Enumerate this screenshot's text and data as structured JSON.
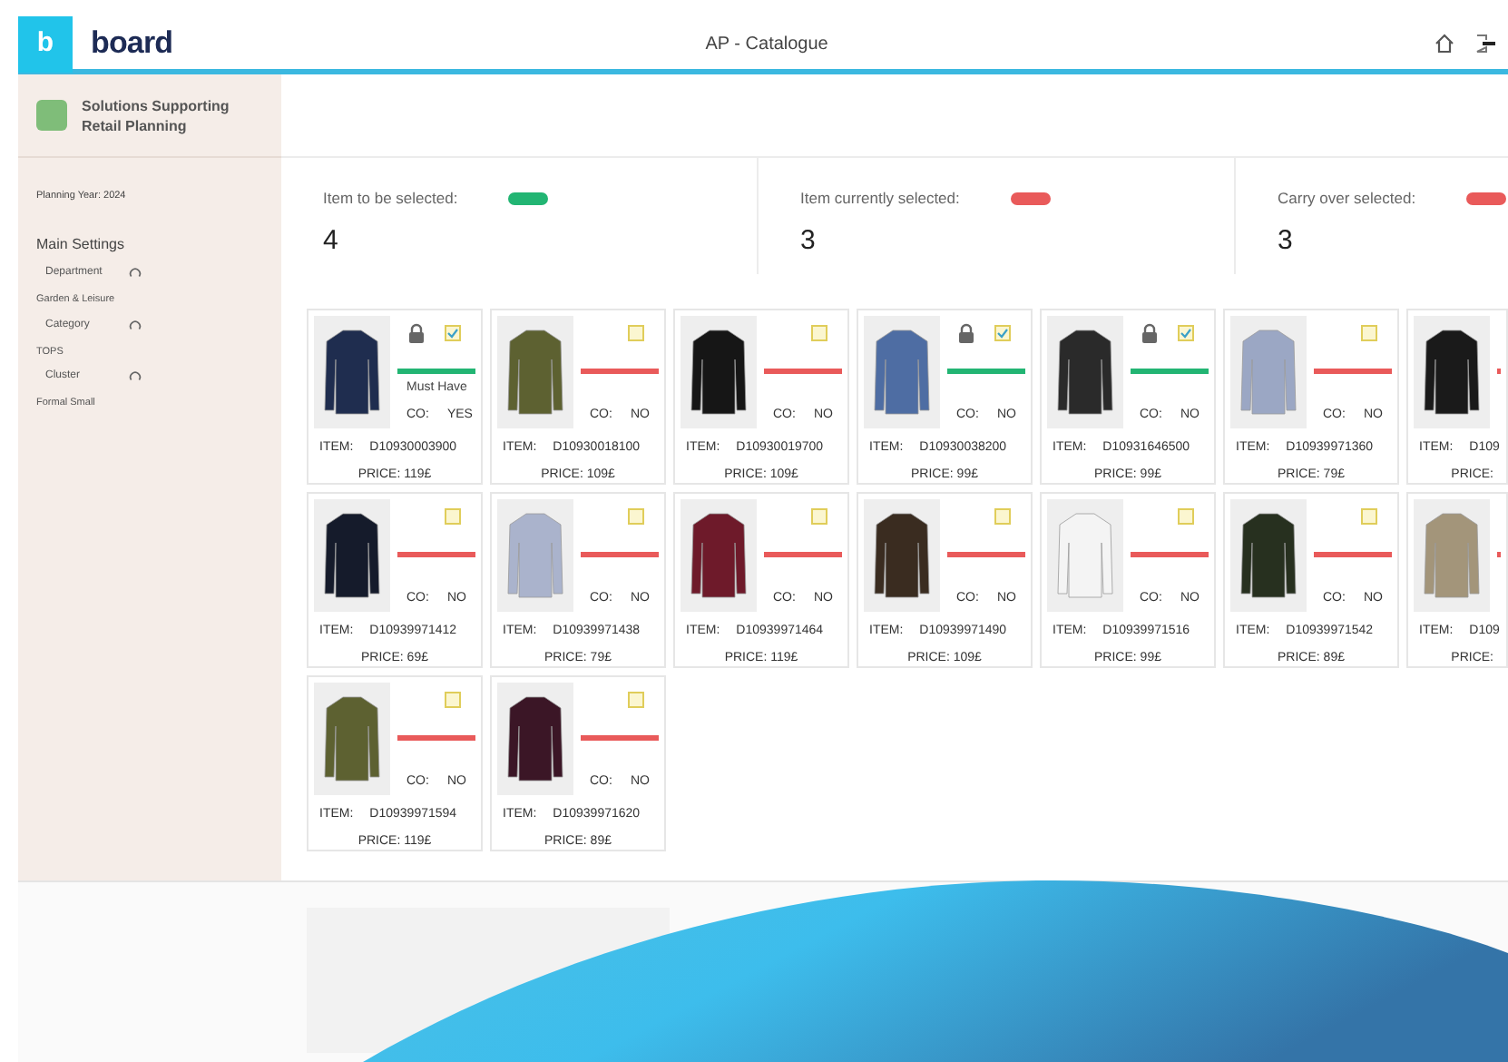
{
  "header": {
    "logo": "b",
    "brand": "board",
    "title": "AP - Catalogue"
  },
  "sidebar": {
    "app_name": [
      "Solutions Supporting",
      "Retail Planning"
    ],
    "planning_year": "Planning Year: 2024",
    "section": "Main Settings",
    "settings": [
      {
        "label": "Department",
        "value": "Garden & Leisure"
      },
      {
        "label": "Category",
        "value": "TOPS"
      },
      {
        "label": "Cluster",
        "value": "Formal Small"
      }
    ]
  },
  "kpis": [
    {
      "label": "Item to be selected:",
      "value": "4",
      "color": "#22b573"
    },
    {
      "label": "Item currently selected:",
      "value": "3",
      "color": "#e95a5a"
    },
    {
      "label": "Carry over selected:",
      "value": "3",
      "color": "#e95a5a"
    }
  ],
  "products": [
    {
      "item_label": "ITEM:",
      "item": "D10930003900",
      "price": "PRICE: 119£",
      "co_label": "CO:",
      "co": "YES",
      "locked": true,
      "checked": true,
      "tag": "Must Have",
      "color": "#1f2d4f"
    },
    {
      "item_label": "ITEM:",
      "item": "D10930018100",
      "price": "PRICE: 109£",
      "co_label": "CO:",
      "co": "NO",
      "locked": false,
      "checked": false,
      "color": "#5d6131"
    },
    {
      "item_label": "ITEM:",
      "item": "D10930019700",
      "price": "PRICE: 109£",
      "co_label": "CO:",
      "co": "NO",
      "locked": false,
      "checked": false,
      "color": "#161616"
    },
    {
      "item_label": "ITEM:",
      "item": "D10930038200",
      "price": "PRICE: 99£",
      "co_label": "CO:",
      "co": "NO",
      "locked": true,
      "checked": true,
      "color": "#4e6da3"
    },
    {
      "item_label": "ITEM:",
      "item": "D10931646500",
      "price": "PRICE: 99£",
      "co_label": "CO:",
      "co": "NO",
      "locked": true,
      "checked": true,
      "color": "#2a2a2a"
    },
    {
      "item_label": "ITEM:",
      "item": "D10939971360",
      "price": "PRICE: 79£",
      "co_label": "CO:",
      "co": "NO",
      "locked": false,
      "checked": false,
      "color": "#9ba7c4"
    },
    {
      "item_label": "ITEM:",
      "item": "D109",
      "price": "PRICE:",
      "color": "#1a1a1a"
    },
    {
      "item_label": "ITEM:",
      "item": "D10939971412",
      "price": "PRICE: 69£",
      "co_label": "CO:",
      "co": "NO",
      "locked": false,
      "checked": false,
      "color": "#151b2b"
    },
    {
      "item_label": "ITEM:",
      "item": "D10939971438",
      "price": "PRICE: 79£",
      "co_label": "CO:",
      "co": "NO",
      "locked": false,
      "checked": false,
      "color": "#aab3cc"
    },
    {
      "item_label": "ITEM:",
      "item": "D10939971464",
      "price": "PRICE: 119£",
      "co_label": "CO:",
      "co": "NO",
      "locked": false,
      "checked": false,
      "color": "#6e1a2a"
    },
    {
      "item_label": "ITEM:",
      "item": "D10939971490",
      "price": "PRICE: 109£",
      "co_label": "CO:",
      "co": "NO",
      "locked": false,
      "checked": false,
      "color": "#3a2c20"
    },
    {
      "item_label": "ITEM:",
      "item": "D10939971516",
      "price": "PRICE: 99£",
      "co_label": "CO:",
      "co": "NO",
      "locked": false,
      "checked": false,
      "color": "#f4f4f4"
    },
    {
      "item_label": "ITEM:",
      "item": "D10939971542",
      "price": "PRICE: 89£",
      "co_label": "CO:",
      "co": "NO",
      "locked": false,
      "checked": false,
      "color": "#27301f"
    },
    {
      "item_label": "ITEM:",
      "item": "D109",
      "price": "PRICE:",
      "color": "#a3957a"
    },
    {
      "item_label": "ITEM:",
      "item": "D10939971594",
      "price": "PRICE: 119£",
      "co_label": "CO:",
      "co": "NO",
      "locked": false,
      "checked": false,
      "color": "#5d6131"
    },
    {
      "item_label": "ITEM:",
      "item": "D10939971620",
      "price": "PRICE: 89£",
      "co_label": "CO:",
      "co": "NO",
      "locked": false,
      "checked": false,
      "color": "#3b1626"
    }
  ]
}
